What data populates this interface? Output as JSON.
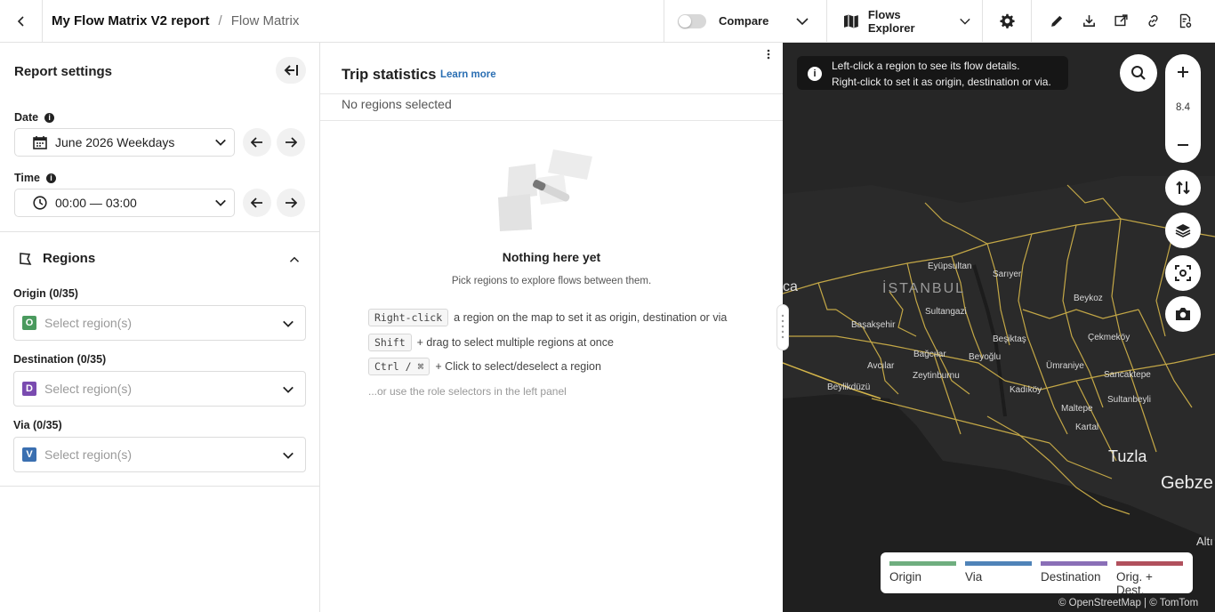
{
  "header": {
    "report_name": "My Flow Matrix V2 report",
    "separator": "/",
    "view_name": "Flow Matrix",
    "compare_label": "Compare",
    "mode_label": "Flows Explorer"
  },
  "left_panel": {
    "title": "Report settings",
    "date_label": "Date",
    "date_value": "June 2026 Weekdays",
    "time_label": "Time",
    "time_value": "00:00 — 03:00",
    "regions_title": "Regions",
    "origin_label": "Origin (0/35)",
    "destination_label": "Destination (0/35)",
    "via_label": "Via (0/35)",
    "origin_badge": "O",
    "destination_badge": "D",
    "via_badge": "V",
    "placeholder": "Select region(s)"
  },
  "middle_panel": {
    "title": "Trip statistics",
    "learn_more": "Learn more",
    "no_regions": "No regions selected",
    "empty_title": "Nothing here yet",
    "empty_sub": "Pick regions to explore flows between them.",
    "hints": [
      {
        "key": "Right-click",
        "text": "a region on the map to set it as origin, destination or via"
      },
      {
        "key": "Shift",
        "text": "+ drag to select multiple regions at once"
      },
      {
        "key": "Ctrl / ⌘",
        "text": "+ Click to select/deselect a region"
      }
    ],
    "hint_last": "...or use the role selectors in the left panel"
  },
  "map": {
    "message_line1": "Left-click a region to see its flow details.",
    "message_line2": "Right-click to set it as origin, destination or via.",
    "zoom_level": "8.4",
    "labels": {
      "istanbul": "İSTANBUL",
      "eyupsultan": "Eyüpsultan",
      "sariyer": "Sarıyer",
      "beykoz": "Beykoz",
      "sultangazi": "Sultangazi",
      "basaksehir": "Başakşehir",
      "besiktas": "Beşiktaş",
      "cekmekoy": "Çekmeköy",
      "bagcilar": "Bağcılar",
      "beyoglu": "Beyoğlu",
      "avcilar": "Avcılar",
      "umraniye": "Ümraniye",
      "sancaktepe": "Sancaktepe",
      "zeytinburnu": "Zeytinburnu",
      "beylikduzu": "Beylikdüzü",
      "kadikoy": "Kadıköy",
      "sultanbeyli": "Sultanbeyli",
      "maltepe": "Maltepe",
      "kartal": "Kartal",
      "tuzla": "Tuzla",
      "gebze": "Gebze",
      "ca": "ca",
      "alti": "Altı"
    },
    "legend": [
      {
        "label": "Origin",
        "color": "#6fae7f"
      },
      {
        "label": "Via",
        "color": "#4f83b8"
      },
      {
        "label": "Destination",
        "color": "#8a6fb7"
      },
      {
        "label": "Orig. + Dest.",
        "color": "#b1505d"
      }
    ],
    "attribution": "© OpenStreetMap | © TomTom"
  },
  "colors": {
    "origin_badge": "#4a9a5e",
    "destination_badge": "#7a4bb0",
    "via_badge": "#3a6fb0",
    "link": "#2b6fb3",
    "map_bg": "#2a2a2a",
    "map_borders": "#d4b54a"
  }
}
